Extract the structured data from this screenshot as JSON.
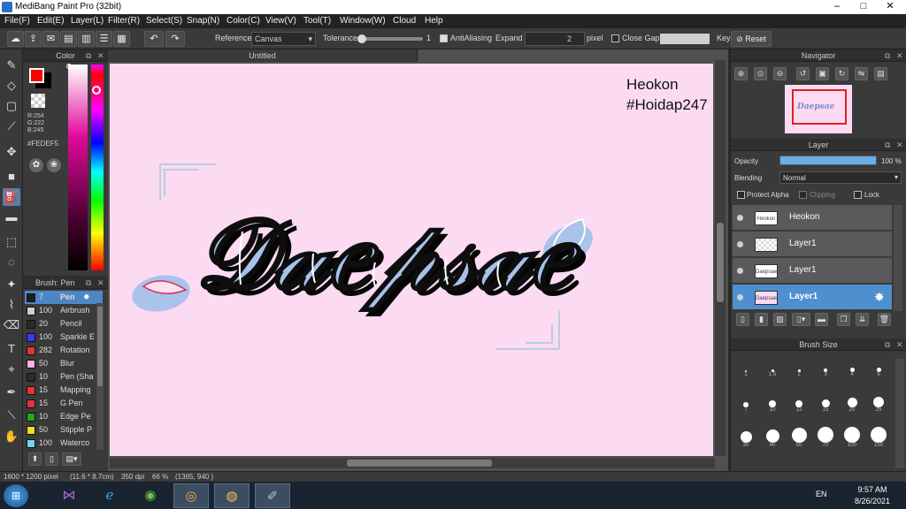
{
  "window": {
    "title": "MediBang Paint Pro (32bit)"
  },
  "menu": [
    "File(F)",
    "Edit(E)",
    "Layer(L)",
    "Filter(R)",
    "Select(S)",
    "Snap(N)",
    "Color(C)",
    "View(V)",
    "Tool(T)",
    "Window(W)",
    "Cloud",
    "Help"
  ],
  "toolbar": {
    "reference_label": "Reference",
    "reference_value": "Canvas",
    "tolerance_label": "Tolerance",
    "tolerance_value": "1",
    "antialiasing_label": "AntiAliasing",
    "expand_label": "Expand",
    "expand_value": "2",
    "expand_unit": "pixel",
    "close_gaps_label": "Close Gaps",
    "key_label": "Key",
    "reset_label": "Reset"
  },
  "color_panel": {
    "title": "Color",
    "r": "R:254",
    "g": "G:222",
    "b": "B:245",
    "hex": "#FEDEF5",
    "foreground": "#ff0000",
    "background_color": "#fedef5"
  },
  "brush_panel": {
    "title": "Brush: Pen",
    "items": [
      {
        "size": "7",
        "name": "Pen",
        "color": "#1e1e1e"
      },
      {
        "size": "100",
        "name": "Airbrush",
        "color": "#cfcfcf"
      },
      {
        "size": "20",
        "name": "Pencil",
        "color": "#2a2a2a"
      },
      {
        "size": "100",
        "name": "Sparkle E",
        "color": "#3a3af0"
      },
      {
        "size": "282",
        "name": "Rotation",
        "color": "#e23535"
      },
      {
        "size": "50",
        "name": "Blur",
        "color": "#f7b0e8"
      },
      {
        "size": "10",
        "name": "Pen (Sha",
        "color": "#2a2a2a"
      },
      {
        "size": "15",
        "name": "Mapping",
        "color": "#e23535"
      },
      {
        "size": "15",
        "name": "G Pen",
        "color": "#e23535"
      },
      {
        "size": "10",
        "name": "Edge Pe",
        "color": "#23a623"
      },
      {
        "size": "50",
        "name": "Stipple P",
        "color": "#e8e020"
      },
      {
        "size": "100",
        "name": "Waterco",
        "color": "#6ed6f2"
      }
    ]
  },
  "document": {
    "tab": "Untitled",
    "watermark_line1": "Heokon",
    "watermark_line2": "#Hoidap247",
    "artwork_word": "Daepsae"
  },
  "navigator": {
    "title": "Navigator"
  },
  "layer_panel": {
    "title": "Layer",
    "opacity_label": "Opacity",
    "opacity_value": "100 %",
    "opacity_fraction": 1.0,
    "blending_label": "Blending",
    "blending_value": "Normal",
    "protect_alpha": "Protect Alpha",
    "clipping": "Clipping",
    "lock": "Lock",
    "layers": [
      {
        "name": "Heokon",
        "thumb": "Heokon #Hoidap247"
      },
      {
        "name": "Layer1",
        "thumb": ""
      },
      {
        "name": "Layer1",
        "thumb": "Daepsae"
      },
      {
        "name": "Layer1",
        "thumb": "Daepsae"
      }
    ]
  },
  "brush_size": {
    "title": "Brush Size",
    "sizes": [
      "1",
      "1.5",
      "2",
      "3",
      "4",
      "5",
      "7",
      "10",
      "12",
      "15",
      "20",
      "25",
      "30",
      "40",
      "50",
      "70",
      "100",
      "150"
    ]
  },
  "status": {
    "dimensions": "1600 * 1200 pixel",
    "physical": "(11.6 * 8.7cm)",
    "dpi": "350 dpi",
    "zoom": "66 %",
    "coords": "(1365, 940 )"
  },
  "taskbar": {
    "language": "EN",
    "time": "9:57 AM",
    "date": "8/26/2021"
  }
}
